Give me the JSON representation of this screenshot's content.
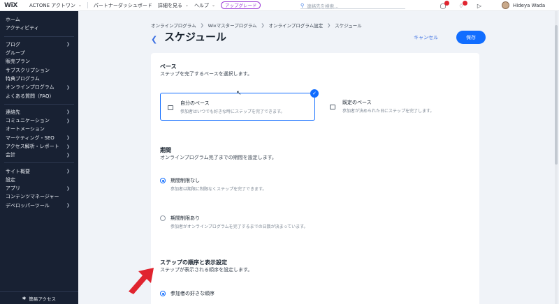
{
  "topbar": {
    "logo": "WiX",
    "site_name": "ACTONE アクトワン",
    "partner": "パートナーダッシュボード",
    "explore": "詳細を見る",
    "help": "ヘルプ",
    "upgrade": "アップグレード",
    "search_placeholder": "連絡先を検索...",
    "user_name": "Hideya Wada"
  },
  "sidebar": {
    "groups": [
      [
        "ホーム",
        "アクティビティ"
      ],
      [
        "ブログ",
        "グループ",
        "販売プラン",
        "サブスクリプション",
        "特典プログラム",
        "オンラインプログラム",
        "よくある質問（FAQ）"
      ],
      [
        "連絡先",
        "コミュニケーション",
        "オートメーション",
        "マーケティング・SEO",
        "アクセス解析・レポート",
        "会計"
      ],
      [
        "サイト概要",
        "設定",
        "アプリ",
        "コンテンツマネージャー",
        "デベロッパーツール"
      ]
    ],
    "bottom": "簡易アクセス"
  },
  "breadcrumb": [
    "オンラインプログラム",
    "Wixマスタープログラム",
    "オンラインプログラム設定",
    "スケジュール"
  ],
  "page_title": "スケジュール",
  "cancel_label": "キャンセル",
  "save_label": "保存",
  "pace_section": {
    "title": "ペース",
    "subtitle": "ステップを完了するペースを選択します。",
    "options": [
      {
        "title": "自分のペース",
        "desc": "参加者はいつでも好きな時にステップを完了できます。"
      },
      {
        "title": "既定のペース",
        "desc": "参加者が決められた日にステップを完了します。"
      }
    ]
  },
  "period_section": {
    "title": "期間",
    "subtitle": "オンラインプログラム完了までの期間を設定します。",
    "options": [
      {
        "label": "期間制限なし",
        "desc": "参加者は期限に制限なくステップを完了できます。"
      },
      {
        "label": "期間制限あり",
        "desc": "参加者がオンラインプログラムを完了するまでの日数が決まっています。"
      }
    ]
  },
  "order_section": {
    "title": "ステップの順序と表示設定",
    "subtitle": "ステップが表示される順序を設定します。",
    "first_option": "参加者の好きな順序"
  },
  "colors": {
    "accent": "#116dff",
    "sidebar_bg": "#182133",
    "arrow": "#e0242f"
  }
}
